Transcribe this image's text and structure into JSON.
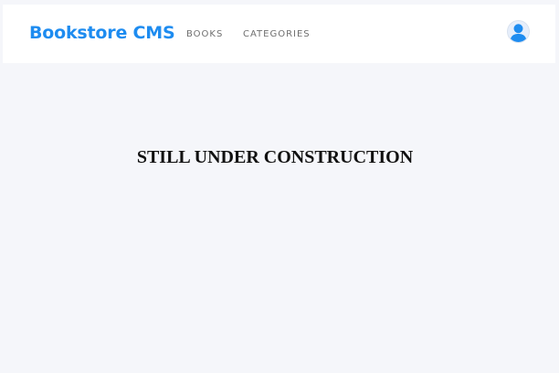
{
  "header": {
    "brand": "Bookstore CMS",
    "nav": [
      {
        "label": "BOOKS"
      },
      {
        "label": "CATEGORIES"
      }
    ],
    "avatar_icon": "user-icon"
  },
  "main": {
    "message": "STILL UNDER CONSTRUCTION"
  },
  "colors": {
    "brand": "#1e8cf0",
    "background": "#f5f6fa",
    "header_background": "#ffffff"
  }
}
